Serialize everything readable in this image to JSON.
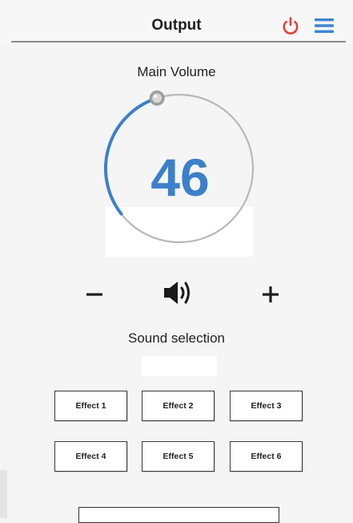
{
  "header": {
    "title": "Output",
    "power_icon": "power-icon",
    "menu_icon": "hamburger-menu-icon",
    "power_color": "#e0433b",
    "menu_color": "#3b86d0"
  },
  "volume": {
    "label": "Main Volume",
    "value": "46",
    "max": 100,
    "accent_color": "#3c80c9"
  },
  "controls": {
    "minus_icon": "minus-icon",
    "speaker_icon": "speaker-icon",
    "plus_icon": "plus-icon"
  },
  "sound": {
    "label": "Sound selection",
    "current": ""
  },
  "effects": [
    {
      "label": "Effect 1"
    },
    {
      "label": "Effect 2"
    },
    {
      "label": "Effect 3"
    },
    {
      "label": "Effect 4"
    },
    {
      "label": "Effect 5"
    },
    {
      "label": "Effect 6"
    }
  ]
}
